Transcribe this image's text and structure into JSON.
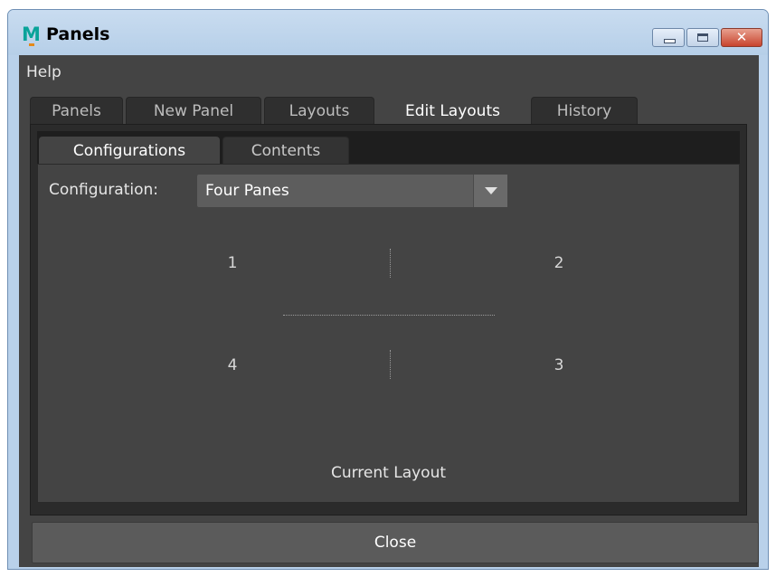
{
  "window": {
    "title": "Panels",
    "app_icon": "maya-m-icon"
  },
  "menubar": {
    "items": [
      "Help"
    ]
  },
  "outer_tabs": [
    {
      "label": "Panels",
      "active": false
    },
    {
      "label": "New Panel",
      "active": false
    },
    {
      "label": "Layouts",
      "active": false
    },
    {
      "label": "Edit Layouts",
      "active": true
    },
    {
      "label": "History",
      "active": false
    }
  ],
  "inner_tabs": [
    {
      "label": "Configurations",
      "active": true
    },
    {
      "label": "Contents",
      "active": false
    }
  ],
  "configuration": {
    "label": "Configuration:",
    "value": "Four Panes"
  },
  "layout_preview": {
    "panes": [
      "1",
      "2",
      "3",
      "4"
    ],
    "caption": "Current Layout"
  },
  "footer": {
    "close_label": "Close"
  },
  "colors": {
    "panel_bg": "#444444",
    "dark_bg": "#2b2b2b",
    "text": "#e6e6e6",
    "titlebar": "#b9d1ea",
    "close_red": "#c8442d"
  }
}
